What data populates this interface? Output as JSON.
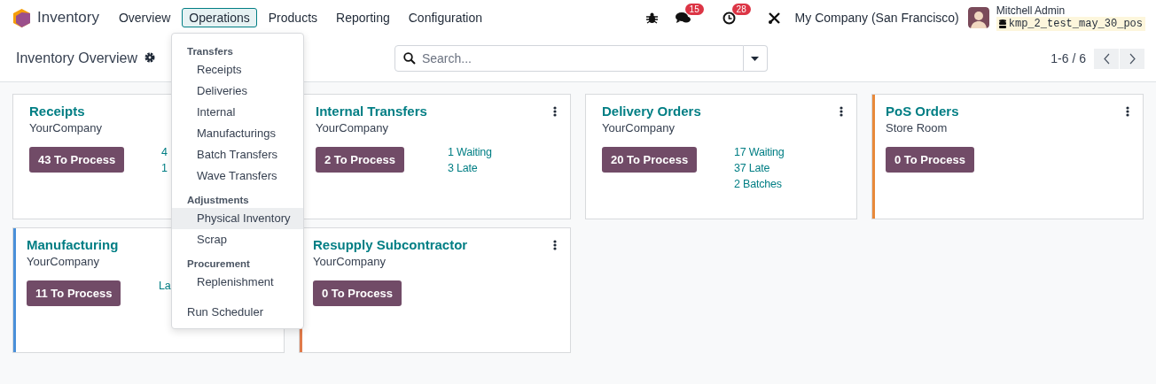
{
  "navbar": {
    "app_name": "Inventory",
    "menus": [
      {
        "label": "Overview",
        "selected": false
      },
      {
        "label": "Operations",
        "selected": true
      },
      {
        "label": "Products",
        "selected": false
      },
      {
        "label": "Reporting",
        "selected": false
      },
      {
        "label": "Configuration",
        "selected": false
      }
    ],
    "messages_count": "15",
    "activities_count": "28",
    "company": "My Company (San Francisco)",
    "user_name": "Mitchell Admin",
    "database": "kmp_2_test_may_30_pos"
  },
  "control_panel": {
    "title": "Inventory Overview",
    "search": {
      "placeholder": "Search..."
    },
    "pager": "1-6 / 6"
  },
  "cards": [
    {
      "title": "Receipts",
      "subtitle": "YourCompany",
      "button": "43 To Process",
      "stats": [
        "4",
        "1"
      ],
      "menu_button": false
    },
    {
      "title": "Internal Transfers",
      "subtitle": "YourCompany",
      "button": "2 To Process",
      "stats": [
        "1 Waiting",
        "3 Late"
      ],
      "menu_button": true
    },
    {
      "title": "Delivery Orders",
      "subtitle": "YourCompany",
      "button": "20 To Process",
      "stats": [
        "17 Waiting",
        "37 Late",
        "2 Batches"
      ],
      "menu_button": true
    },
    {
      "title": "PoS Orders",
      "subtitle": "Store Room",
      "button": "0 To Process",
      "menu_button": true,
      "color": "#e8893a"
    },
    {
      "title": "Manufacturing",
      "subtitle": "YourCompany",
      "button": "11 To Process",
      "stats": [
        "La"
      ],
      "menu_button": false,
      "color": "#4a90d9"
    },
    {
      "title": "Resupply Subcontractor",
      "subtitle": "YourCompany",
      "button": "0 To Process",
      "menu_button": true,
      "color": "#e07a4a"
    }
  ],
  "dropdown": {
    "entries": [
      {
        "kind": "header",
        "label": "Transfers"
      },
      {
        "kind": "item",
        "label": "Receipts",
        "highlighted": false
      },
      {
        "kind": "item",
        "label": "Deliveries",
        "highlighted": false
      },
      {
        "kind": "item",
        "label": "Internal",
        "highlighted": false
      },
      {
        "kind": "item",
        "label": "Manufacturings",
        "highlighted": false
      },
      {
        "kind": "item",
        "label": "Batch Transfers",
        "highlighted": false
      },
      {
        "kind": "item",
        "label": "Wave Transfers",
        "highlighted": false
      },
      {
        "kind": "header",
        "label": "Adjustments"
      },
      {
        "kind": "item",
        "label": "Physical Inventory",
        "highlighted": true
      },
      {
        "kind": "item",
        "label": "Scrap",
        "highlighted": false
      },
      {
        "kind": "header",
        "label": "Procurement"
      },
      {
        "kind": "item",
        "label": "Replenishment",
        "highlighted": false
      },
      {
        "kind": "action",
        "label": "Run Scheduler",
        "highlighted": false
      }
    ]
  }
}
